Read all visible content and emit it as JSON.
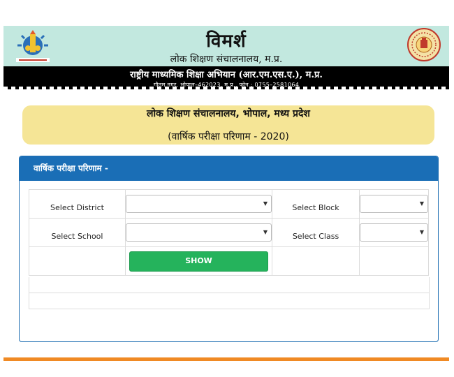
{
  "header": {
    "title": "विमर्श",
    "subtitle": "लोक शिक्षण संचालनालय, म.प्र.",
    "program": "राष्ट्रीय माध्यमिक शिक्षा अभियान (आर.एम.एस.ए.), म.प्र.",
    "address": "गौतम नगर, भोपाल–462023, म.प्र., फोन : 0755–2581064",
    "left_logo": "education-mascot-logo",
    "right_logo": "mp-government-emblem"
  },
  "title_box": {
    "line1": "लोक शिक्षण संचालनालय, भोपाल, मध्य प्रदेश",
    "line2": "(वार्षिक परीक्षा परिणाम - 2020)"
  },
  "panel": {
    "heading": "वार्षिक परीक्षा परिणाम -",
    "district_label": "Select District",
    "district_value": "",
    "block_label": "Select Block",
    "block_value": "",
    "school_label": "Select School",
    "school_value": "",
    "class_label": "Select Class",
    "class_value": "",
    "show_label": "SHOW"
  },
  "colors": {
    "banner_bg": "#c2e8df",
    "title_box_bg": "#f5e596",
    "panel_heading_bg": "#1a6eb6",
    "show_button_bg": "#25b35c",
    "footer_bar": "#f08a24"
  }
}
